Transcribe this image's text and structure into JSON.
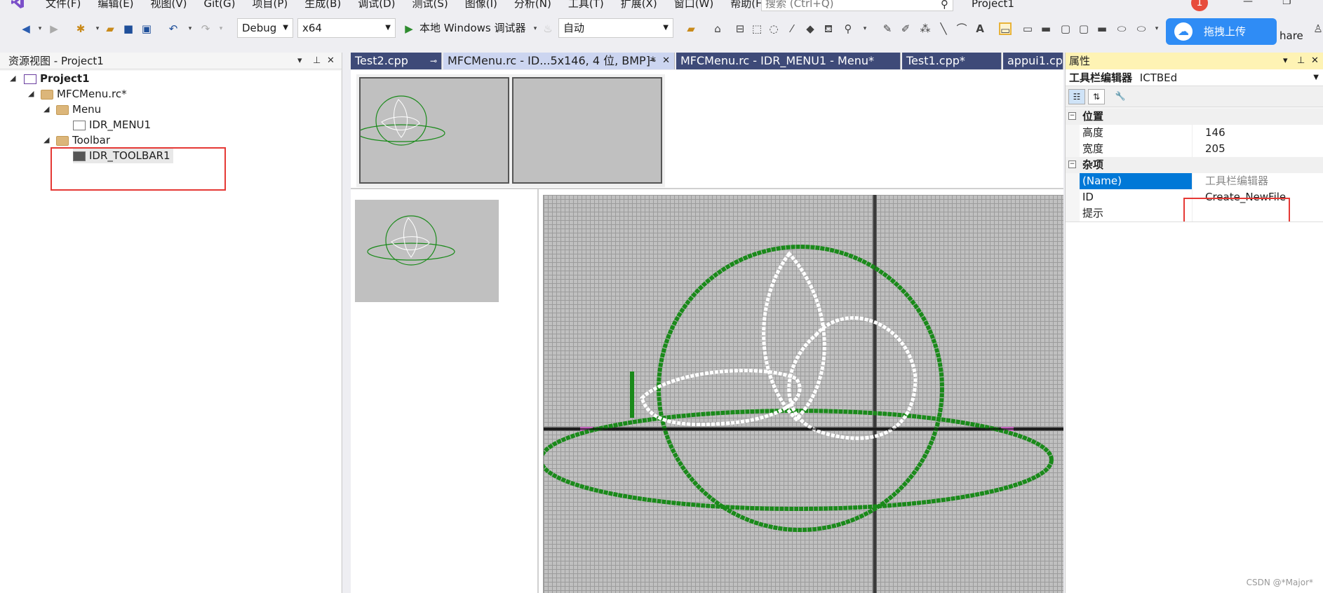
{
  "menu": {
    "items": [
      "文件(F)",
      "编辑(E)",
      "视图(V)",
      "Git(G)",
      "项目(P)",
      "生成(B)",
      "调试(D)",
      "测试(S)",
      "图像(I)",
      "分析(N)",
      "工具(T)",
      "扩展(X)",
      "窗口(W)",
      "帮助(H)"
    ],
    "search_placeholder": "搜索 (Ctrl+Q)",
    "project_name": "Project1",
    "notification_count": "1"
  },
  "toolbar": {
    "config": "Debug",
    "platform": "x64",
    "run_label": "本地 Windows 调试器",
    "auto": "自动",
    "upload_label": "拖拽上传",
    "share_label": "hare"
  },
  "left_panel": {
    "title": "资源视图 - Project1",
    "tree": {
      "project": "Project1",
      "rc_file": "MFCMenu.rc*",
      "menu_folder": "Menu",
      "menu_item": "IDR_MENU1",
      "toolbar_folder": "Toolbar",
      "toolbar_item": "IDR_TOOLBAR1"
    }
  },
  "tabs": [
    {
      "label": "Test2.cpp",
      "pin": "⊸"
    },
    {
      "label": "MFCMenu.rc - ID...5x146, 4 位, BMP]*"
    },
    {
      "label": "MFCMenu.rc - IDR_MENU1 - Menu*"
    },
    {
      "label": "Test1.cpp*"
    },
    {
      "label": "appui1.cpp"
    }
  ],
  "properties": {
    "title": "属性",
    "editor_label": "工具栏编辑器",
    "editor_class": "ICTBEd",
    "cat_position": "位置",
    "height_key": "高度",
    "height_val": "146",
    "width_key": "宽度",
    "width_val": "205",
    "cat_misc": "杂项",
    "name_key": "(Name)",
    "name_val": "工具栏编辑器",
    "id_key": "ID",
    "id_val": "Create_NewFile",
    "tip_key": "提示",
    "tip_val": ""
  },
  "watermark": "CSDN @*Major*"
}
